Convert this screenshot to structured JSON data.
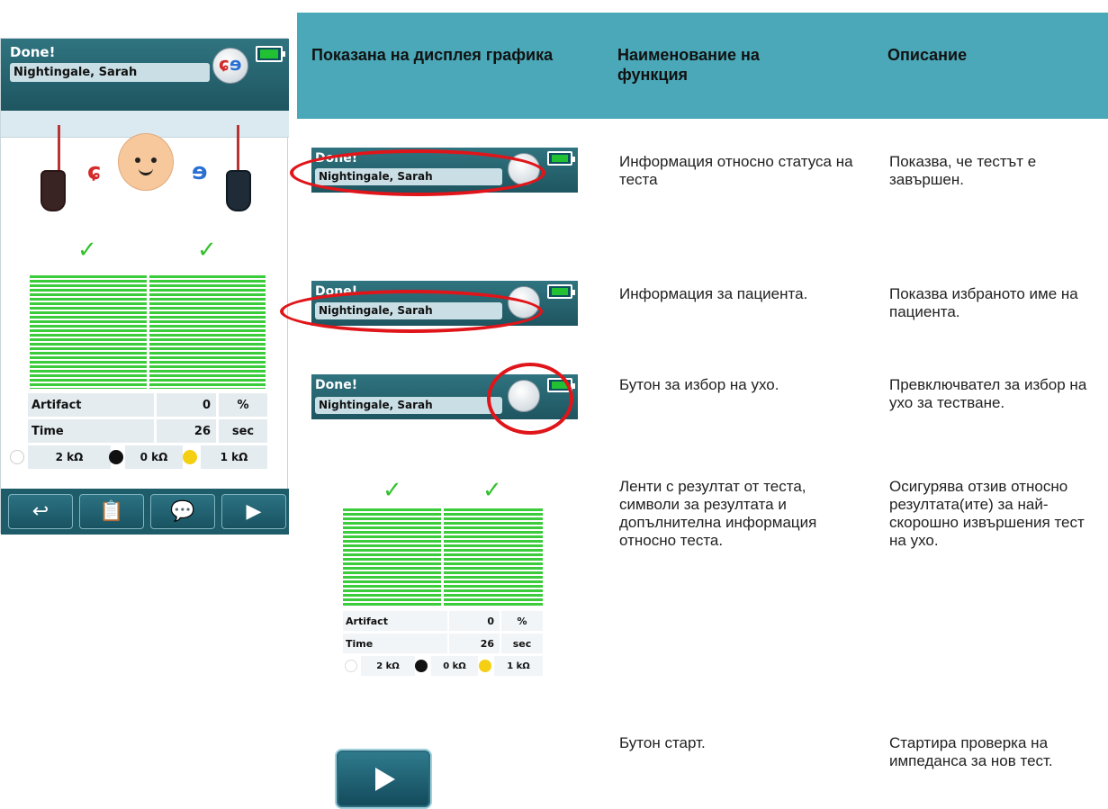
{
  "device": {
    "status": "Done!",
    "patient": "Nightingale, Sarah",
    "table": {
      "artifact_label": "Artifact",
      "artifact_value": "0",
      "artifact_unit": "%",
      "time_label": "Time",
      "time_value": "26",
      "time_unit": "sec",
      "imp1": "2 kΩ",
      "imp2": "0 kΩ",
      "imp3": "1 kΩ"
    },
    "footer_icons": [
      "return-icon",
      "clipboard-icon",
      "comment-icon",
      "play-icon"
    ],
    "footer_glyphs": [
      "↩",
      "📋",
      "💬",
      "▶"
    ]
  },
  "header": {
    "col1": "Показана на дисплея графика",
    "col2": "Наименование на функция",
    "col3": "Описание"
  },
  "rows": [
    {
      "name": "Информация относно статуса на теста",
      "desc": "Показва, че тестът е завършен."
    },
    {
      "name": "Информация за пациента.",
      "desc": "Показва избраното име на пациента."
    },
    {
      "name": "Бутон за избор на ухо.",
      "desc": "Превключвател за избор на ухо за тестване."
    },
    {
      "name": "Ленти с резултат от теста, символи за резултата и допълнителна информация относно теста.",
      "desc": "Осигурява отзив относно резултата(ите) за най-скорошно извършения тест на ухо."
    },
    {
      "name": "Бутон старт.",
      "desc": "Стартира проверка на импеданса за нов тест."
    }
  ],
  "colors": {
    "header_band": "#4aa8b8",
    "device_header": "#1e5560",
    "result_green": "#3acc3a",
    "highlight_red": "#e0151a"
  }
}
